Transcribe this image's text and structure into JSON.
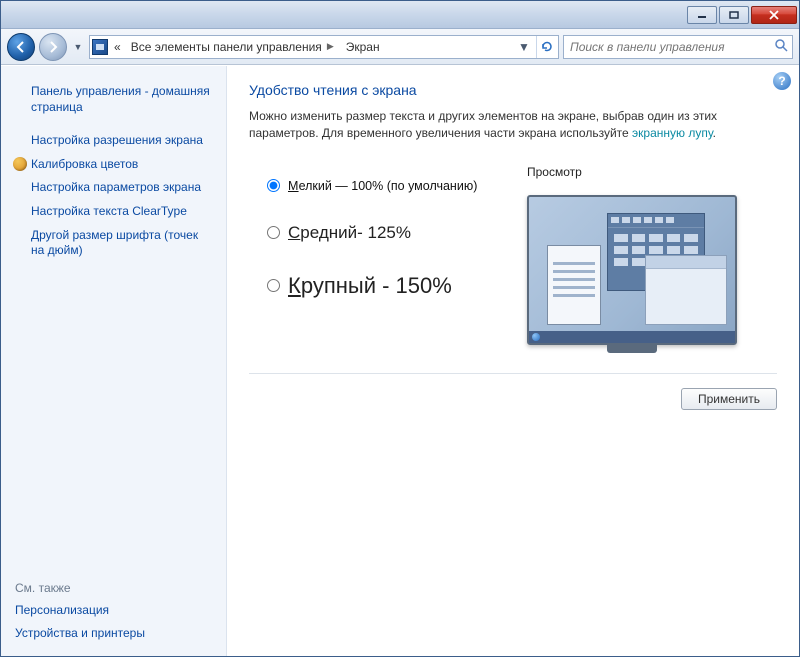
{
  "titlebar": {
    "min": "–",
    "max": "▭",
    "close": "✕"
  },
  "nav": {
    "breadcrumb_chevrons": "«",
    "crumb1": "Все элементы панели управления",
    "crumb2": "Экран",
    "search_placeholder": "Поиск в панели управления"
  },
  "sidebar": {
    "home": "Панель управления - домашняя страница",
    "resolution": "Настройка разрешения экрана",
    "calibrate": "Калибровка цветов",
    "params": "Настройка параметров экрана",
    "cleartype": "Настройка текста ClearType",
    "dpi": "Другой размер шрифта (точек на дюйм)",
    "seealso": "См. также",
    "personalization": "Персонализация",
    "devices": "Устройства и принтеры"
  },
  "main": {
    "help": "?",
    "title": "Удобство чтения с экрана",
    "desc1": "Можно изменить размер текста и других элементов на экране, выбрав один из этих параметров. Для временного увеличения части экрана используйте ",
    "desc_link": "экранную лупу",
    "opt_small_pre": "М",
    "opt_small_rest": "елкий — 100% (по умолчанию)",
    "opt_medium_pre": "С",
    "opt_medium_rest": "редний- 125%",
    "opt_large_pre": "К",
    "opt_large_rest": "рупный - 150%",
    "preview_label": "Просмотр",
    "apply": "Применить"
  }
}
